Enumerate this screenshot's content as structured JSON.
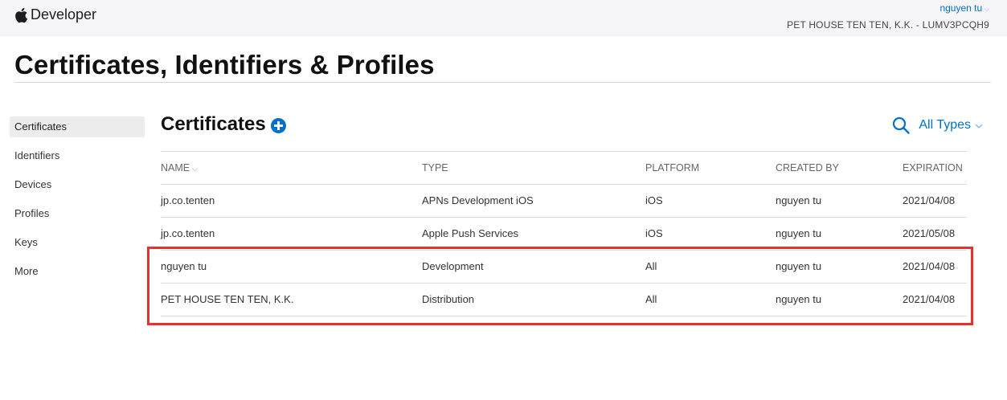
{
  "header": {
    "brand": "Developer",
    "user": "nguyen tu",
    "team": "PET HOUSE TEN TEN, K.K. - LUMV3PCQH9"
  },
  "page_title": "Certificates, Identifiers & Profiles",
  "sidebar": {
    "items": [
      {
        "label": "Certificates",
        "active": true
      },
      {
        "label": "Identifiers",
        "active": false
      },
      {
        "label": "Devices",
        "active": false
      },
      {
        "label": "Profiles",
        "active": false
      },
      {
        "label": "Keys",
        "active": false
      },
      {
        "label": "More",
        "active": false
      }
    ]
  },
  "section": {
    "title": "Certificates",
    "filter": "All Types"
  },
  "table": {
    "columns": [
      "NAME",
      "TYPE",
      "PLATFORM",
      "CREATED BY",
      "EXPIRATION"
    ],
    "rows": [
      [
        "jp.co.tenten",
        "APNs Development iOS",
        "iOS",
        "nguyen tu",
        "2021/04/08"
      ],
      [
        "jp.co.tenten",
        "Apple Push Services",
        "iOS",
        "nguyen tu",
        "2021/05/08"
      ],
      [
        "nguyen tu",
        "Development",
        "All",
        "nguyen tu",
        "2021/04/08"
      ],
      [
        "PET HOUSE TEN TEN, K.K.",
        "Distribution",
        "All",
        "nguyen tu",
        "2021/04/08"
      ]
    ]
  },
  "colors": {
    "accent": "#0070c9",
    "highlight": "#e8302c",
    "topbar": "#f5f5f7"
  }
}
